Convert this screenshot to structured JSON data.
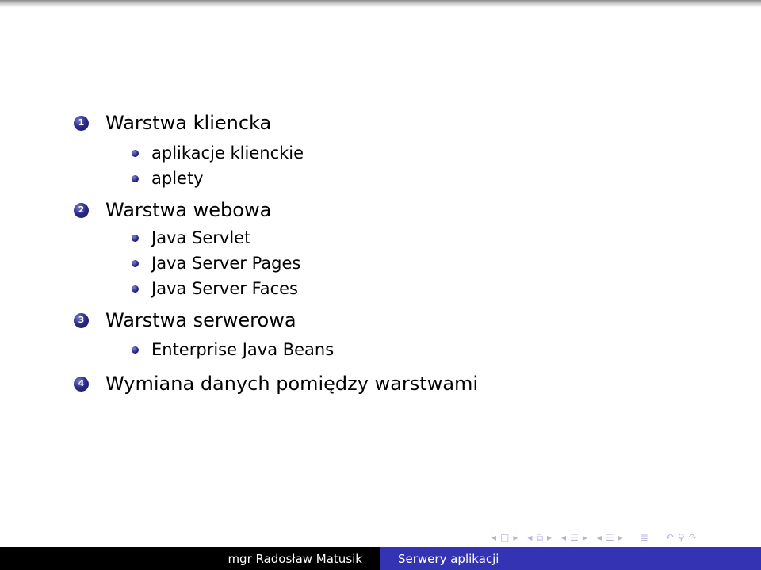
{
  "outline": [
    {
      "number": "1",
      "title": "Warstwa kliencka",
      "items": [
        "aplikacje klienckie",
        "aplety"
      ]
    },
    {
      "number": "2",
      "title": "Warstwa webowa",
      "items": [
        "Java Servlet",
        "Java Server Pages",
        "Java Server Faces"
      ]
    },
    {
      "number": "3",
      "title": "Warstwa serwerowa",
      "items": [
        "Enterprise Java Beans"
      ]
    },
    {
      "number": "4",
      "title": "Wymiana danych pomiędzy warstwami",
      "items": []
    }
  ],
  "navigation": {
    "icons": [
      "nav-left-arrow",
      "frame-icon",
      "nav-right-arrow",
      "nav-left-arrow",
      "subsection-icon",
      "nav-right-arrow",
      "nav-left-arrow",
      "section-icon",
      "nav-right-arrow",
      "nav-left-arrow",
      "subsection-list-icon",
      "nav-right-arrow",
      "document-icon",
      "back-icon",
      "search-icon",
      "forward-icon"
    ],
    "glyphs": {
      "left": "◂",
      "right": "▸",
      "frame": "□",
      "subsection": "⧉",
      "section": "☰",
      "document": "≣",
      "back": "↶",
      "search": "⚲",
      "forward": "↷"
    }
  },
  "footer": {
    "author": "mgr Radosław Matusik",
    "title": "Serwery aplikacji",
    "colors": {
      "left_bg": "#000000",
      "right_bg": "#3333b3"
    }
  }
}
